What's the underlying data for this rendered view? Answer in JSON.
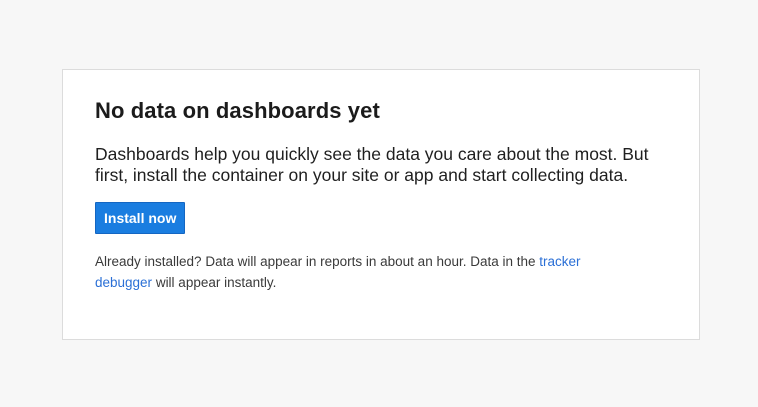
{
  "card": {
    "title": "No data on dashboards yet",
    "description": "Dashboards help you quickly see the data you care about the most. But first, install the container on your site or app and start collecting data.",
    "button_label": "Install now",
    "note_prefix": "Already installed? Data will appear in reports in about an hour. Data in the ",
    "note_link": "tracker debugger",
    "note_suffix": " will appear instantly."
  },
  "colors": {
    "page_background": "#f7f7f7",
    "card_background": "#ffffff",
    "button_background": "#1a7de0",
    "link": "#2a6fd6"
  }
}
